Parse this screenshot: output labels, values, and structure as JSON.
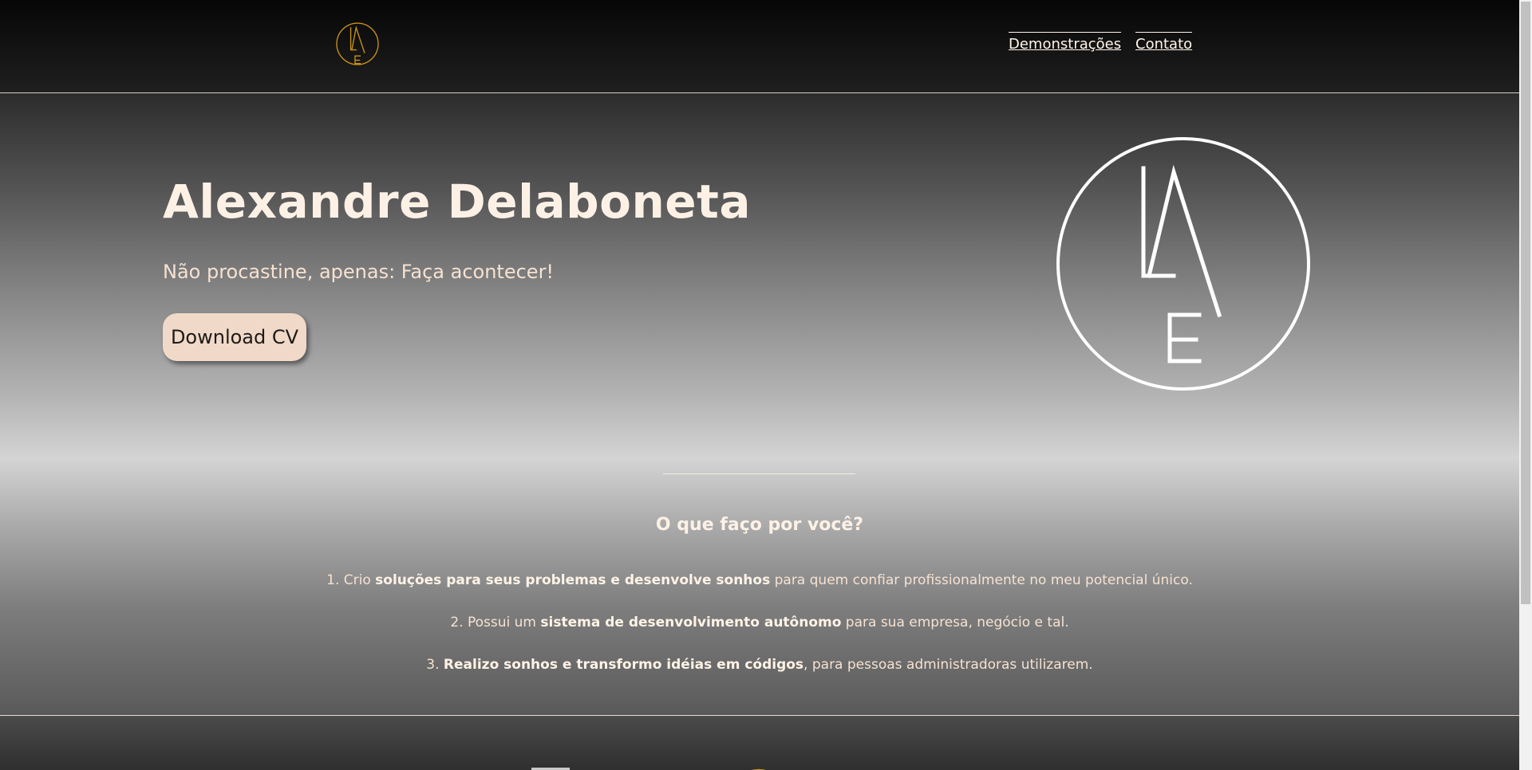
{
  "header": {
    "logo": {
      "icon": "lae-monogram-icon",
      "color": "#c8911a"
    },
    "nav": [
      {
        "label": "Demonstrações"
      },
      {
        "label": "Contato"
      }
    ]
  },
  "hero": {
    "title": "Alexandre Delaboneta",
    "subtitle": "Não procastine, apenas: Faça acontecer!",
    "cta_label": "Download CV",
    "logo": {
      "icon": "lae-monogram-icon",
      "color": "#ffffff"
    }
  },
  "services": {
    "title": "O que faço por você?",
    "items": [
      {
        "num": "1. ",
        "pre": "Crio ",
        "strong": "soluções para seus problemas e desenvolve sonhos",
        "post": " para quem confiar profissionalmente no meu potencial único."
      },
      {
        "num": "2. ",
        "pre": "Possui um ",
        "strong": "sistema de desenvolvimento autônomo",
        "post": " para sua empresa, negócio e tal."
      },
      {
        "num": "3. ",
        "pre": "",
        "strong": "Realizo sonhos e transformo idéias em códigos",
        "post": ", para pessoas administradoras utilizarem."
      }
    ]
  },
  "footer": {
    "logo": {
      "icon": "lae-monogram-icon",
      "color": "#c8911a"
    }
  },
  "colors": {
    "accent_gold": "#c8911a",
    "text_cream": "#fdf1e6",
    "button_bg": "#f0d9c8"
  }
}
